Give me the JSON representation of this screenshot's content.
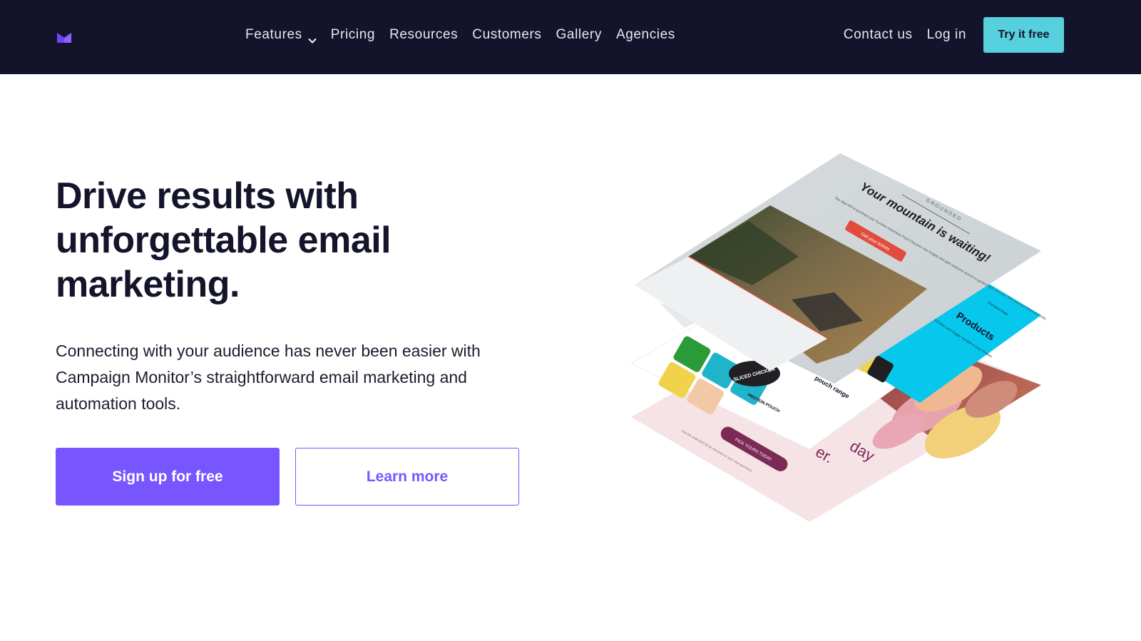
{
  "nav": {
    "logo_icon": "campaign-monitor-envelope-logo",
    "links": [
      {
        "label": "Features",
        "has_dropdown": true
      },
      {
        "label": "Pricing"
      },
      {
        "label": "Resources"
      },
      {
        "label": "Customers"
      },
      {
        "label": "Gallery"
      },
      {
        "label": "Agencies"
      }
    ],
    "contact_label": "Contact us",
    "login_label": "Log in",
    "try_label": "Try it free"
  },
  "hero": {
    "title": "Drive results with unforgettable email marketing.",
    "subtitle": "Connecting with your audience has never been easier with Campaign Monitor’s straightforward email marketing and automation tools.",
    "primary_cta": "Sign up for free",
    "secondary_cta": "Learn more"
  },
  "illustration": {
    "top_card": {
      "brand": "GROUNDED",
      "headline": "Your mountain is waiting!",
      "body": "Two days left to purchase your Summer Adventure Pass! Discover new heights and gain exclusive access to guided tours and over 300 mountain hikes and trails.",
      "cta": "Get your tickets"
    },
    "product_card": {
      "tag": "Feel good foods",
      "headline": "Products",
      "body": "Chicken and veggie sample in your Protein",
      "item1": "SLICED CHICKEN",
      "item2": "PROTEIN POUCH",
      "range_label": "pouch range"
    },
    "bottom_card": {
      "headline_part1": "day",
      "headline_part2": "er.",
      "cta": "PICK YOURS TODAY",
      "fine_print": "Use the code MACS5 at checkout on your next purchase."
    }
  },
  "colors": {
    "nav_bg": "#13132b",
    "accent_purple": "#7856ff",
    "accent_cyan": "#56d0dc"
  }
}
